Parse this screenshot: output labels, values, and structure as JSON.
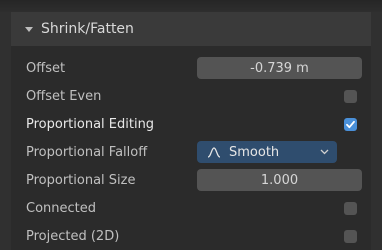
{
  "panel": {
    "title": "Shrink/Fatten"
  },
  "rows": {
    "offset": {
      "label": "Offset",
      "value": "-0.739 m"
    },
    "offset_even": {
      "label": "Offset Even",
      "checked": false
    },
    "proportional_editing": {
      "label": "Proportional Editing",
      "checked": true
    },
    "proportional_falloff": {
      "label": "Proportional Falloff",
      "value": "Smooth",
      "icon": "smooth-falloff-icon"
    },
    "proportional_size": {
      "label": "Proportional Size",
      "value": "1.000"
    },
    "connected": {
      "label": "Connected",
      "checked": false
    },
    "projected_2d": {
      "label": "Projected (2D)",
      "checked": false
    }
  },
  "colors": {
    "checkbox_on": "#4a90d9",
    "dropdown_bg": "#2f4d6e",
    "field_bg": "#545454"
  }
}
